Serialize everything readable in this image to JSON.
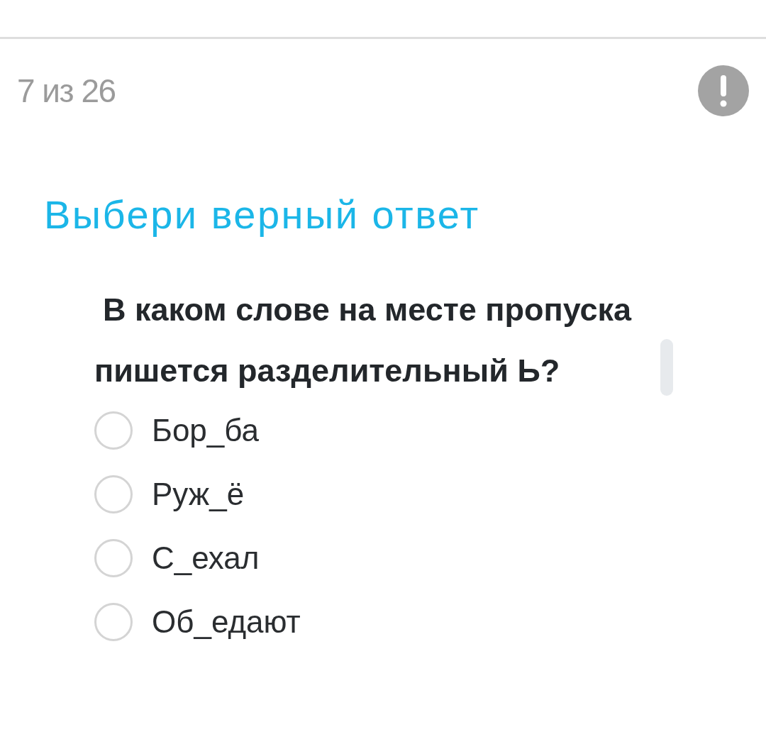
{
  "header": {
    "progress": "7 из 26"
  },
  "task": {
    "title": "Выбери верный ответ",
    "question": "В каком слове на месте пропуска пишется разделительный Ь?"
  },
  "options": [
    {
      "label": "Бор_ба",
      "selected": false
    },
    {
      "label": "Руж_ё",
      "selected": false
    },
    {
      "label": "С_ехал",
      "selected": false
    },
    {
      "label": "Об_едают",
      "selected": false
    }
  ]
}
